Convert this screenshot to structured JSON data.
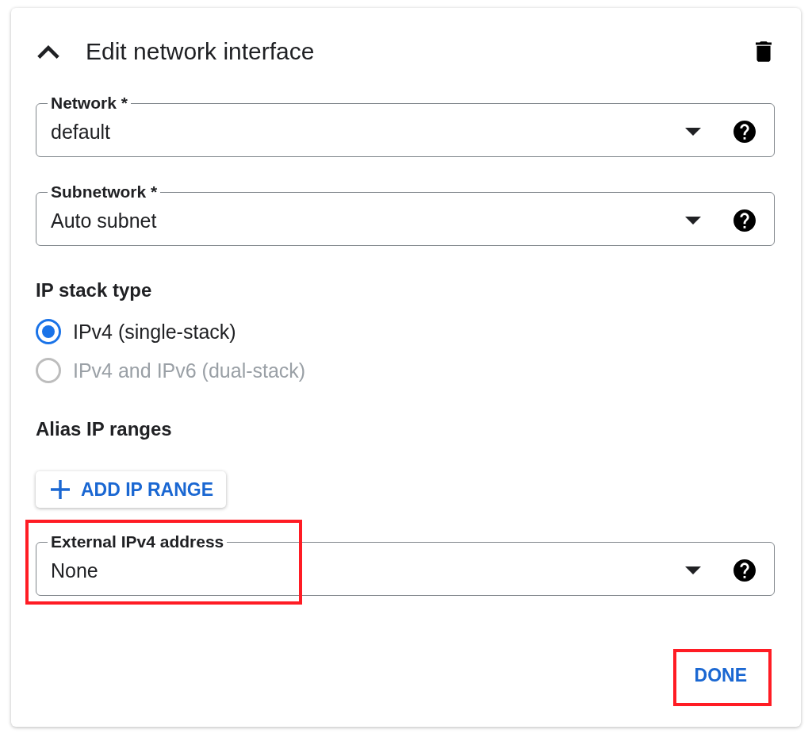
{
  "header": {
    "title": "Edit network interface",
    "expanded": true
  },
  "fields": [
    {
      "label": "Network *",
      "value": "default",
      "highlighted": false
    },
    {
      "label": "Subnetwork *",
      "value": "Auto subnet",
      "highlighted": false
    }
  ],
  "ip_stack": {
    "title": "IP stack type",
    "options": [
      {
        "label": "IPv4 (single-stack)",
        "selected": true,
        "disabled": false
      },
      {
        "label": "IPv4 and IPv6 (dual-stack)",
        "selected": false,
        "disabled": true
      }
    ]
  },
  "alias_ip": {
    "title": "Alias IP ranges",
    "button": "ADD IP RANGE"
  },
  "external_ipv4": {
    "label": "External IPv4 address",
    "value": "None",
    "highlighted": true
  },
  "done_button": {
    "label": "DONE",
    "highlighted": true
  }
}
